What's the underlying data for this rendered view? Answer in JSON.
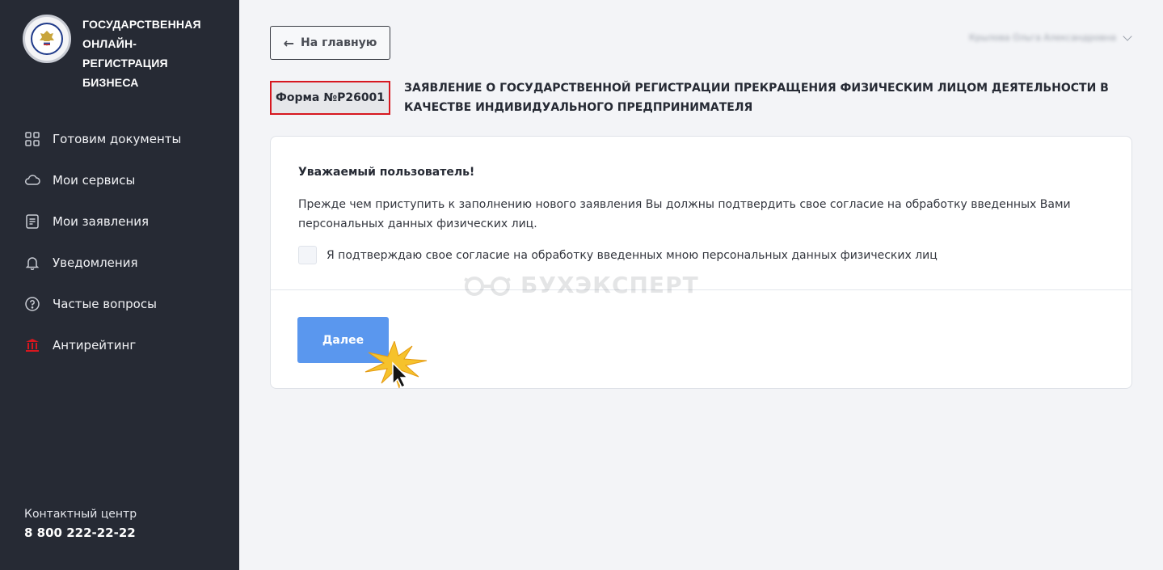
{
  "sidebar": {
    "brand": {
      "line1": "ГОСУДАРСТВЕННАЯ",
      "line2": "ОНЛАЙН-РЕГИСТРАЦИЯ",
      "line3": "БИЗНЕСА"
    },
    "items": [
      {
        "label": "Готовим документы",
        "icon": "grid-icon"
      },
      {
        "label": "Мои сервисы",
        "icon": "cloud-icon"
      },
      {
        "label": "Мои заявления",
        "icon": "document-icon"
      },
      {
        "label": "Уведомления",
        "icon": "bell-icon"
      },
      {
        "label": "Частые вопросы",
        "icon": "question-icon"
      },
      {
        "label": "Антирейтинг",
        "icon": "building-icon"
      }
    ],
    "contact": {
      "label": "Контактный центр",
      "phone": "8 800 222-22-22"
    }
  },
  "header": {
    "back_label": "На главную",
    "user_name": "Крылова Ольга Александровна"
  },
  "form": {
    "badge": "Форма №Р26001",
    "title": "ЗАЯВЛЕНИЕ О ГОСУДАРСТВЕННОЙ РЕГИСТРАЦИИ ПРЕКРАЩЕНИЯ ФИЗИЧЕСКИМ ЛИЦОМ ДЕЯТЕЛЬНОСТИ В КАЧЕСТВЕ ИНДИВИДУАЛЬНОГО ПРЕДПРИНИМАТЕЛЯ"
  },
  "card": {
    "greeting": "Уважаемый пользователь!",
    "text": "Прежде чем приступить к заполнению нового заявления Вы должны подтвердить свое согласие на обработку введенных Вами персональных данных физических лиц.",
    "consent_label": "Я подтверждаю свое согласие на обработку введенных мною персональных данных физических лиц",
    "consent_checked": false,
    "next_label": "Далее"
  },
  "watermark": "БУХЭКСПЕРТ",
  "colors": {
    "sidebar_bg": "#262a34",
    "accent_blue": "#5a97ee",
    "highlight_red": "#d7171f",
    "antirating_red": "#d7171f"
  }
}
